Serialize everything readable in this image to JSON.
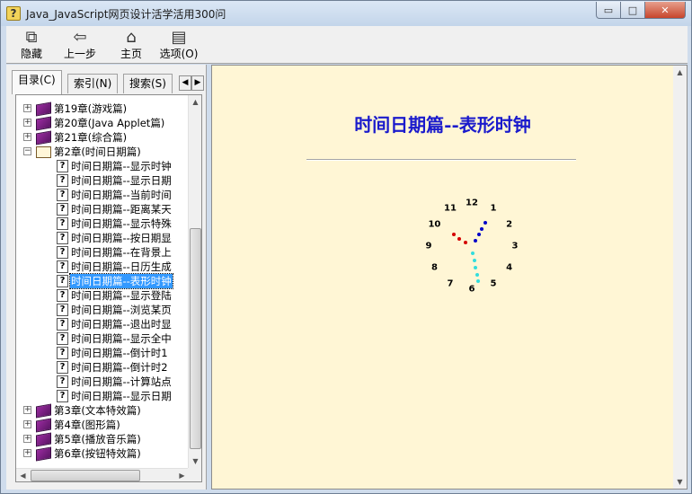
{
  "window": {
    "title": "Java_JavaScript网页设计活学活用300问",
    "min_label": "▭",
    "max_label": "□",
    "close_label": "✕"
  },
  "toolbar": [
    {
      "name": "hide-button",
      "label": "隐藏",
      "icon": "⧉",
      "icon_name": "hide-pane-icon"
    },
    {
      "name": "back-button",
      "label": "上一步",
      "icon": "⇦",
      "icon_name": "back-arrow-icon"
    },
    {
      "name": "home-button",
      "label": "主页",
      "icon": "⌂",
      "icon_name": "home-icon"
    },
    {
      "name": "options-button",
      "label": "选项(O)",
      "icon": "▤",
      "icon_name": "options-icon"
    }
  ],
  "tabs": [
    {
      "label": "目录(C)",
      "active": true
    },
    {
      "label": "索引(N)",
      "active": false
    },
    {
      "label": "搜索(S)",
      "active": false
    }
  ],
  "tree": [
    {
      "level": 0,
      "kind": "book",
      "expander": "+",
      "label": "第19章(游戏篇)"
    },
    {
      "level": 0,
      "kind": "book",
      "expander": "+",
      "label": "第20章(Java Applet篇)"
    },
    {
      "level": 0,
      "kind": "book",
      "expander": "+",
      "label": "第21章(综合篇)"
    },
    {
      "level": 0,
      "kind": "open",
      "expander": "−",
      "label": "第2章(时间日期篇)"
    },
    {
      "level": 1,
      "kind": "page",
      "label": "时间日期篇--显示时钟"
    },
    {
      "level": 1,
      "kind": "page",
      "label": "时间日期篇--显示日期"
    },
    {
      "level": 1,
      "kind": "page",
      "label": "时间日期篇--当前时间"
    },
    {
      "level": 1,
      "kind": "page",
      "label": "时间日期篇--距离某天"
    },
    {
      "level": 1,
      "kind": "page",
      "label": "时间日期篇--显示特殊"
    },
    {
      "level": 1,
      "kind": "page",
      "label": "时间日期篇--按日期显"
    },
    {
      "level": 1,
      "kind": "page",
      "label": "时间日期篇--在背景上"
    },
    {
      "level": 1,
      "kind": "page",
      "label": "时间日期篇--日历生成"
    },
    {
      "level": 1,
      "kind": "page",
      "label": "时间日期篇--表形时钟",
      "selected": true
    },
    {
      "level": 1,
      "kind": "page",
      "label": "时间日期篇--显示登陆"
    },
    {
      "level": 1,
      "kind": "page",
      "label": "时间日期篇--浏览某页"
    },
    {
      "level": 1,
      "kind": "page",
      "label": "时间日期篇--退出时显"
    },
    {
      "level": 1,
      "kind": "page",
      "label": "时间日期篇--显示全中"
    },
    {
      "level": 1,
      "kind": "page",
      "label": "时间日期篇--倒计时1"
    },
    {
      "level": 1,
      "kind": "page",
      "label": "时间日期篇--倒计时2"
    },
    {
      "level": 1,
      "kind": "page",
      "label": "时间日期篇--计算站点"
    },
    {
      "level": 1,
      "kind": "page",
      "label": "时间日期篇--显示日期"
    },
    {
      "level": 0,
      "kind": "book",
      "expander": "+",
      "label": "第3章(文本特效篇)"
    },
    {
      "level": 0,
      "kind": "book",
      "expander": "+",
      "label": "第4章(图形篇)"
    },
    {
      "level": 0,
      "kind": "book",
      "expander": "+",
      "label": "第5章(播放音乐篇)"
    },
    {
      "level": 0,
      "kind": "book",
      "expander": "+",
      "label": "第6章(按钮特效篇)"
    }
  ],
  "content": {
    "title": "时间日期篇--表形时钟",
    "title_color": "#1a1acc",
    "background": "#fff6d5",
    "clock": {
      "numbers": [
        "12",
        "1",
        "2",
        "3",
        "4",
        "5",
        "6",
        "7",
        "8",
        "9",
        "10",
        "11"
      ],
      "hour_hand_color": "#d40000",
      "minute_hand_color": "#0000c8",
      "second_hand_color": "#33dddd"
    }
  }
}
